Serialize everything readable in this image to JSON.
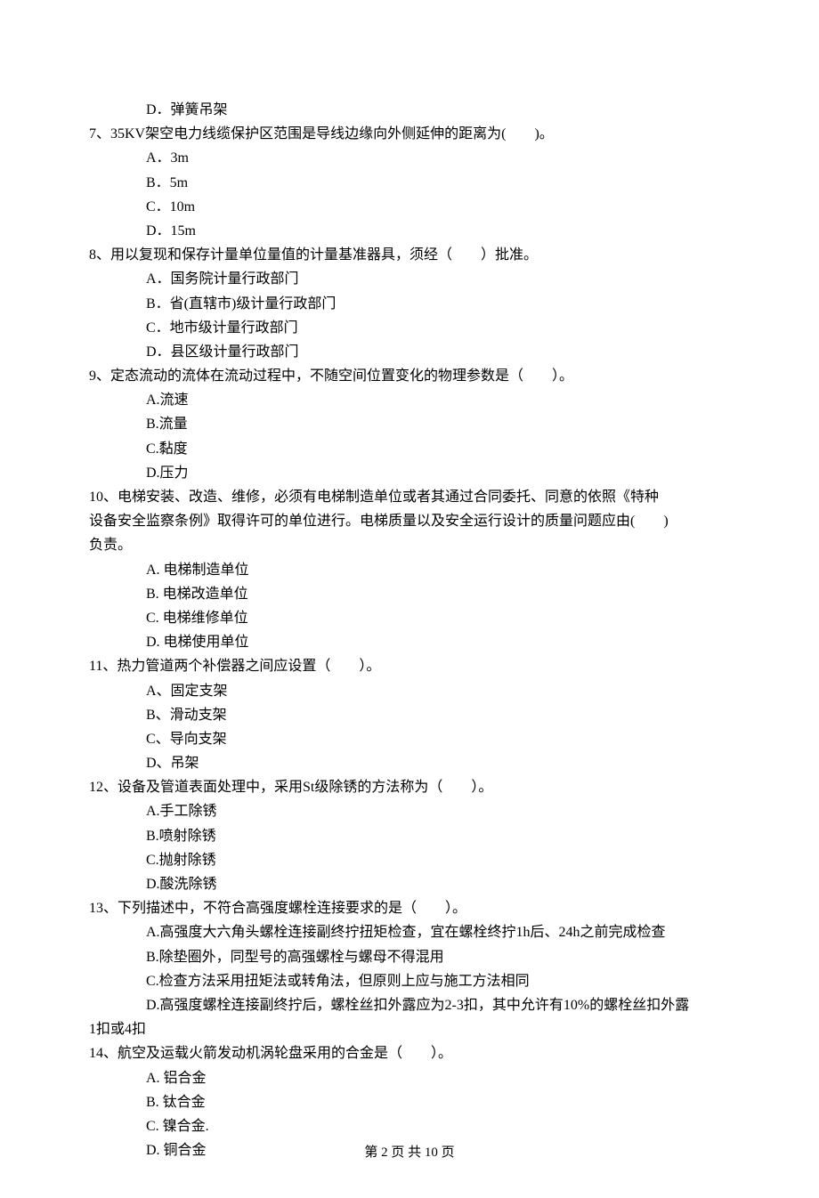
{
  "pre_option": "D．弹簧吊架",
  "q7": {
    "stem": "7、35KV架空电力线缆保护区范围是导线边缘向外侧延伸的距离为(　　)。",
    "A": "A．3m",
    "B": "B．5m",
    "C": "C．10m",
    "D": "D．15m"
  },
  "q8": {
    "stem": "8、用以复现和保存计量单位量值的计量基准器具，须经（　　）批准。",
    "A": "A．国务院计量行政部门",
    "B": "B．省(直辖市)级计量行政部门",
    "C": "C．地市级计量行政部门",
    "D": "D．县区级计量行政部门"
  },
  "q9": {
    "stem": "9、定态流动的流体在流动过程中，不随空间位置变化的物理参数是（　　）。",
    "A": "A.流速",
    "B": "B.流量",
    "C": "C.黏度",
    "D": "D.压力"
  },
  "q10": {
    "stem1": "10、电梯安装、改造、维修，必须有电梯制造单位或者其通过合同委托、同意的依照《特种",
    "stem2": "设备安全监察条例》取得许可的单位进行。电梯质量以及安全运行设计的质量问题应由(　　)",
    "stem3": "负责。",
    "A": "A. 电梯制造单位",
    "B": "B. 电梯改造单位",
    "C": "C. 电梯维修单位",
    "D": "D. 电梯使用单位"
  },
  "q11": {
    "stem": "11、热力管道两个补偿器之间应设置（　　）。",
    "A": "A、固定支架",
    "B": "B、滑动支架",
    "C": "C、导向支架",
    "D": "D、吊架"
  },
  "q12": {
    "stem": "12、设备及管道表面处理中，采用St级除锈的方法称为（　　）。",
    "A": "A.手工除锈",
    "B": "B.喷射除锈",
    "C": "C.抛射除锈",
    "D": "D.酸洗除锈"
  },
  "q13": {
    "stem": "13、下列描述中，不符合高强度螺栓连接要求的是（　　）。",
    "A": "A.高强度大六角头螺栓连接副终拧扭矩检查，宜在螺栓终拧1h后、24h之前完成检查",
    "B": "B.除垫圈外，同型号的高强螺栓与螺母不得混用",
    "C": "C.检查方法采用扭矩法或转角法，但原则上应与施工方法相同",
    "D1": "D.高强度螺栓连接副终拧后，螺栓丝扣外露应为2-3扣，其中允许有10%的螺栓丝扣外露",
    "D2": "1扣或4扣"
  },
  "q14": {
    "stem": "14、航空及运载火箭发动机涡轮盘采用的合金是（　　）。",
    "A": "A. 铝合金",
    "B": "B. 钛合金",
    "C": "C. 镍合金.",
    "D": "D. 铜合金"
  },
  "footer": "第 2 页 共 10 页"
}
